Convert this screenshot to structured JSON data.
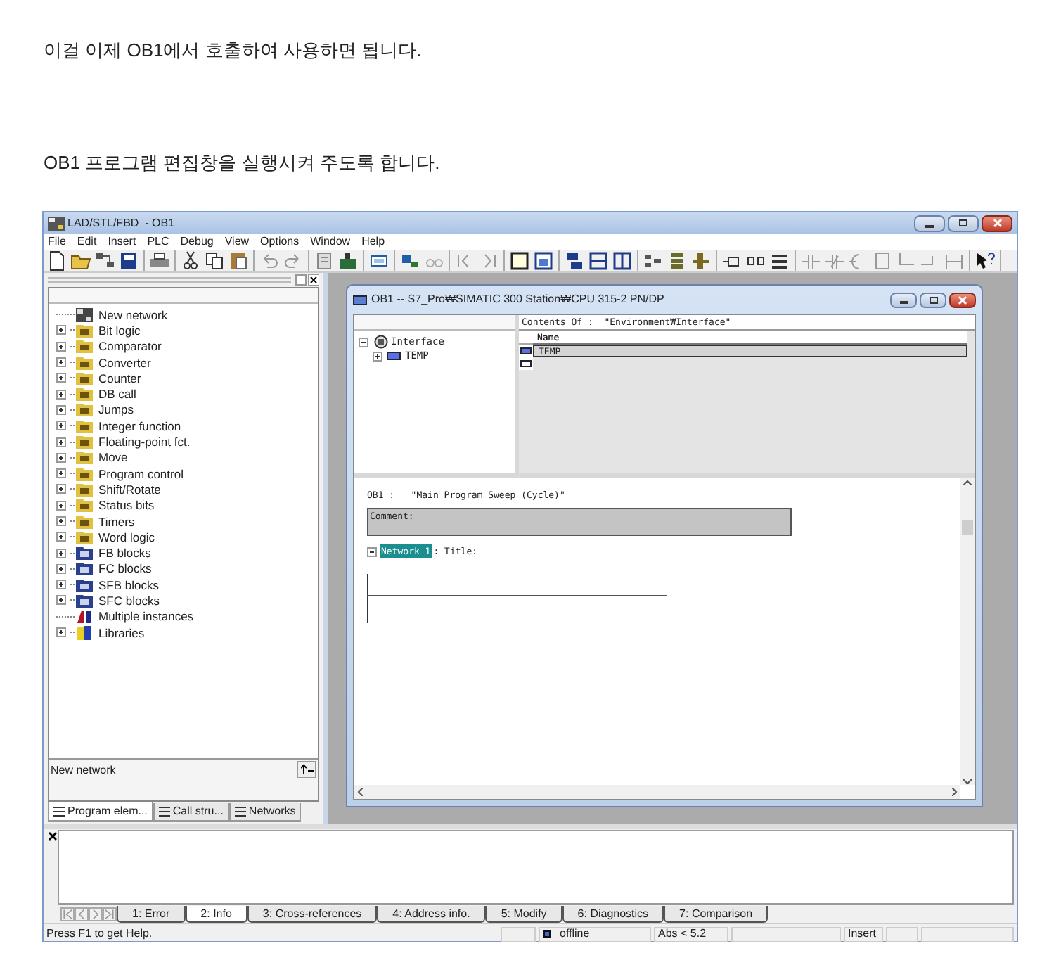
{
  "article": {
    "intro": "이걸 이제 OB1에서 호출하여 사용하면 됩니다.",
    "step": "OB1 프로그램 편집창을 실행시켜 주도록 합니다."
  },
  "window": {
    "title": "LAD/STL/FBD  - OB1"
  },
  "menu": [
    "File",
    "Edit",
    "Insert",
    "PLC",
    "Debug",
    "View",
    "Options",
    "Window",
    "Help"
  ],
  "catalog": {
    "items": [
      {
        "label": "New network",
        "kind": "network",
        "expandable": false
      },
      {
        "label": "Bit logic",
        "kind": "folder",
        "expandable": true
      },
      {
        "label": "Comparator",
        "kind": "folder",
        "expandable": true
      },
      {
        "label": "Converter",
        "kind": "folder",
        "expandable": true
      },
      {
        "label": "Counter",
        "kind": "folder",
        "expandable": true
      },
      {
        "label": "DB call",
        "kind": "folder",
        "expandable": true
      },
      {
        "label": "Jumps",
        "kind": "folder",
        "expandable": true
      },
      {
        "label": "Integer function",
        "kind": "folder",
        "expandable": true
      },
      {
        "label": "Floating-point fct.",
        "kind": "folder",
        "expandable": true
      },
      {
        "label": "Move",
        "kind": "folder",
        "expandable": true
      },
      {
        "label": "Program control",
        "kind": "folder",
        "expandable": true
      },
      {
        "label": "Shift/Rotate",
        "kind": "folder",
        "expandable": true
      },
      {
        "label": "Status bits",
        "kind": "folder",
        "expandable": true
      },
      {
        "label": "Timers",
        "kind": "folder",
        "expandable": true
      },
      {
        "label": "Word logic",
        "kind": "folder",
        "expandable": true
      },
      {
        "label": "FB blocks",
        "kind": "block",
        "expandable": true
      },
      {
        "label": "FC blocks",
        "kind": "block",
        "expandable": true
      },
      {
        "label": "SFB blocks",
        "kind": "block",
        "expandable": true
      },
      {
        "label": "SFC blocks",
        "kind": "block",
        "expandable": true
      },
      {
        "label": "Multiple instances",
        "kind": "instances",
        "expandable": false
      },
      {
        "label": "Libraries",
        "kind": "library",
        "expandable": true
      }
    ],
    "description": "New network",
    "tabs": [
      {
        "label": "Program elem...",
        "selected": true
      },
      {
        "label": "Call stru...",
        "selected": false
      },
      {
        "label": "Networks",
        "selected": false
      }
    ]
  },
  "editor": {
    "title": "OB1 -- S7_Pro₩SIMATIC 300 Station₩CPU 315-2 PN/DP",
    "interface_tree": {
      "label": "Interface",
      "expanded": true,
      "children": [
        {
          "label": "TEMP",
          "expanded": false
        }
      ]
    },
    "contents_header": "Contents Of :  \"Environment₩Interface\"",
    "columns": [
      "Name"
    ],
    "rows": [
      {
        "name": "TEMP",
        "selected": true
      }
    ],
    "block_title": "OB1 :   \"Main Program Sweep (Cycle)\"",
    "comment_label": "Comment:",
    "network": {
      "label": "Network 1",
      "title": ": Title:",
      "expanded": true
    }
  },
  "output": {
    "tabs": [
      {
        "label": "1: Error",
        "selected": false
      },
      {
        "label": "2: Info",
        "selected": true
      },
      {
        "label": "3: Cross-references",
        "selected": false
      },
      {
        "label": "4: Address info.",
        "selected": false
      },
      {
        "label": "5: Modify",
        "selected": false
      },
      {
        "label": "6: Diagnostics",
        "selected": false
      },
      {
        "label": "7: Comparison",
        "selected": false
      }
    ]
  },
  "status_bar": {
    "help": "Press F1 to get Help.",
    "mode": "offline",
    "address": "Abs < 5.2",
    "input": "Insert"
  }
}
